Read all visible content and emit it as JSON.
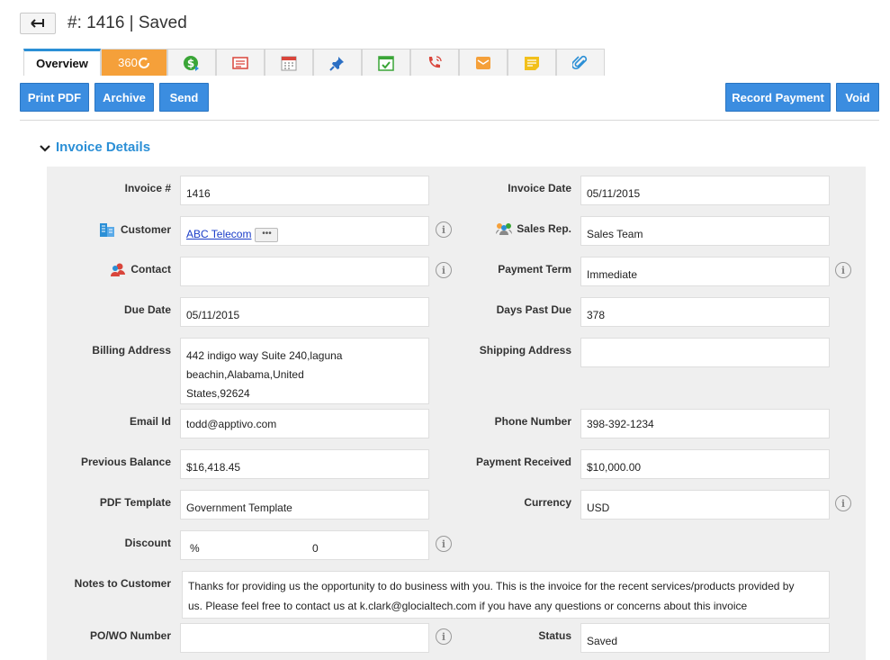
{
  "header": {
    "title": "#: 1416 | Saved"
  },
  "tabs": [
    {
      "label": "Overview"
    },
    {
      "label": "360"
    }
  ],
  "tab_icons": [
    "dollar-icon",
    "invoice-icon",
    "calendar-icon",
    "pin-icon",
    "task-icon",
    "call-icon",
    "email-icon",
    "note-icon",
    "attachment-icon"
  ],
  "actions": {
    "print_pdf": "Print PDF",
    "archive": "Archive",
    "send": "Send",
    "record_payment": "Record Payment",
    "void": "Void"
  },
  "section": {
    "title": "Invoice Details"
  },
  "fields": {
    "invoice_no": {
      "label": "Invoice #",
      "value": "1416"
    },
    "invoice_date": {
      "label": "Invoice Date",
      "value": "05/11/2015"
    },
    "customer": {
      "label": "Customer",
      "value": "ABC Telecom",
      "more": "•••"
    },
    "sales_rep": {
      "label": "Sales Rep.",
      "value": "Sales Team"
    },
    "contact": {
      "label": "Contact",
      "value": ""
    },
    "payment_term": {
      "label": "Payment Term",
      "value": "Immediate"
    },
    "due_date": {
      "label": "Due Date",
      "value": "05/11/2015"
    },
    "days_past_due": {
      "label": "Days Past Due",
      "value": "378"
    },
    "billing_address": {
      "label": "Billing Address",
      "line1": "442 indigo way Suite 240,laguna",
      "line2": "beachin,Alabama,United",
      "line3": "States,92624"
    },
    "shipping_address": {
      "label": "Shipping Address",
      "value": ""
    },
    "email_id": {
      "label": "Email Id",
      "value": "todd@apptivo.com"
    },
    "phone_number": {
      "label": "Phone Number",
      "value": "398-392-1234"
    },
    "previous_balance": {
      "label": "Previous Balance",
      "value": "$16,418.45"
    },
    "payment_received": {
      "label": "Payment Received",
      "value": "$10,000.00"
    },
    "pdf_template": {
      "label": "PDF Template",
      "value": "Government Template"
    },
    "currency": {
      "label": "Currency",
      "value": "USD"
    },
    "discount": {
      "label": "Discount",
      "unit": "%",
      "value": "0"
    },
    "notes_to_customer": {
      "label": "Notes to Customer",
      "line1": "Thanks for providing us the opportunity to do business with you. This is the invoice for the recent services/products provided by",
      "line2": "us. Please feel free to contact us at k.clark@glocialtech.com if you have any questions or concerns about this invoice"
    },
    "po_wo_number": {
      "label": "PO/WO Number",
      "value": ""
    },
    "status": {
      "label": "Status",
      "value": "Saved"
    }
  },
  "info_symbol": "i"
}
